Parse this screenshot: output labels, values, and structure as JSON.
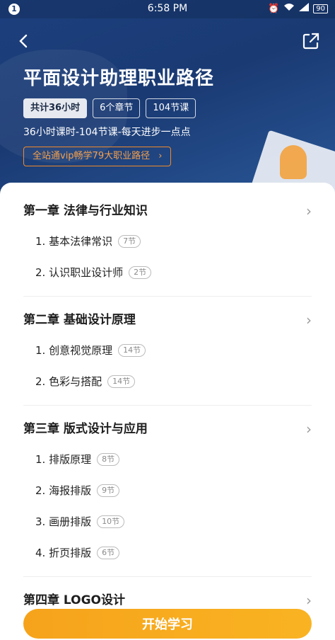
{
  "status": {
    "badge": "1",
    "time": "6:58 PM",
    "battery": "90"
  },
  "course": {
    "title": "平面设计助理职业路径",
    "tags": [
      "共计36小时",
      "6个章节",
      "104节课"
    ],
    "subtitle": "36小时课时-104节课-每天进步一点点",
    "vip_label": "全站通vip畅学79大职业路径",
    "vip_chevron": "›"
  },
  "chapters": [
    {
      "title": "第一章 法律与行业知识",
      "lessons": [
        {
          "label": "1. 基本法律常识",
          "count": "7节"
        },
        {
          "label": "2. 认识职业设计师",
          "count": "2节"
        }
      ]
    },
    {
      "title": "第二章 基础设计原理",
      "lessons": [
        {
          "label": "1. 创意视觉原理",
          "count": "14节"
        },
        {
          "label": "2. 色彩与搭配",
          "count": "14节"
        }
      ]
    },
    {
      "title": "第三章 版式设计与应用",
      "lessons": [
        {
          "label": "1. 排版原理",
          "count": "8节"
        },
        {
          "label": "2. 海报排版",
          "count": "9节"
        },
        {
          "label": "3. 画册排版",
          "count": "10节"
        },
        {
          "label": "4. 折页排版",
          "count": "6节"
        }
      ]
    },
    {
      "title": "第四章 LOGO设计",
      "lessons": []
    }
  ],
  "chevron": "›",
  "start_label": "开始学习",
  "colors": {
    "accent": "#f6a31b",
    "hero": "#1c3f7d"
  },
  "icons": {
    "back": "back-arrow-icon",
    "share": "share-icon",
    "chevron": "chevron-right-icon"
  }
}
